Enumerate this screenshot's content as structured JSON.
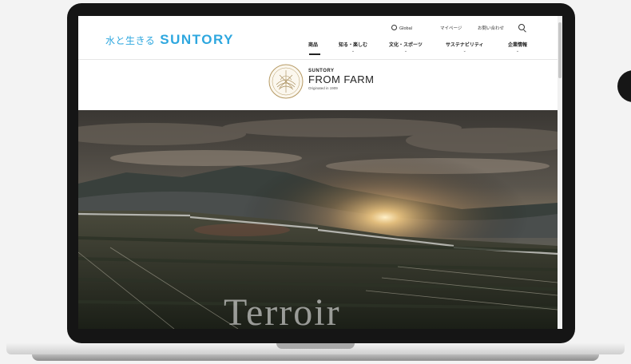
{
  "header": {
    "brand_jp": "水と生きる",
    "brand_name": "SUNTORY",
    "util": [
      "Global",
      "マイページ",
      "お問い合わせ"
    ],
    "nav": [
      "商品",
      "知る・楽しむ",
      "文化・スポーツ",
      "サステナビリティ",
      "企業情報"
    ],
    "chevron": "⌄"
  },
  "from_farm": {
    "brand": "SUNTORY",
    "title": "FROM FARM",
    "sub": "Originated in 1909"
  },
  "hero": {
    "text": "Terroir"
  },
  "icons": {
    "search": "search-icon",
    "globe": "globe-icon"
  },
  "colors": {
    "brand": "#2ea7df"
  }
}
